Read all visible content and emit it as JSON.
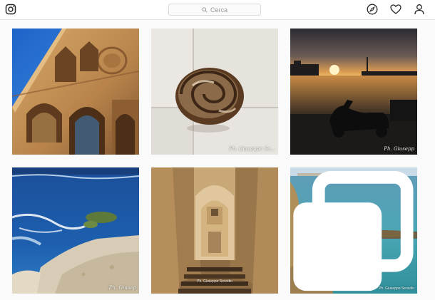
{
  "header": {
    "search_placeholder": "Cerca",
    "icons": [
      "instagram-logo-icon",
      "search-icon",
      "compass-icon",
      "heart-icon",
      "profile-icon"
    ]
  },
  "posts": [
    {
      "id": 1,
      "subject": "gothic-palace-facade",
      "watermark": ""
    },
    {
      "id": 2,
      "subject": "snail-on-tiles",
      "watermark": "Ph. Giuseppe Se..."
    },
    {
      "id": 3,
      "subject": "sunset-harbor-scooter",
      "watermark": "Ph. Giusepp"
    },
    {
      "id": 4,
      "subject": "blue-sea-rocky-shore",
      "watermark": "Ph. Giusep"
    },
    {
      "id": 5,
      "subject": "narrow-stone-alley-stairs",
      "watermark": "Ph. Giuseppe Servidio"
    },
    {
      "id": 6,
      "subject": "turquoise-coast-rocks",
      "watermark": "Ph. Giuseppe Servidio",
      "multi_photo": true
    }
  ],
  "colors": {
    "topbar_bg": "#ffffff",
    "page_bg": "#fafafa",
    "border": "#e6e6e6"
  }
}
